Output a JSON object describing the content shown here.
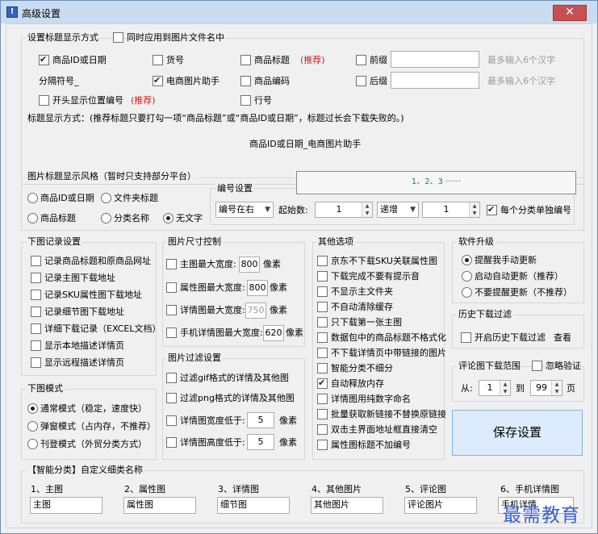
{
  "window": {
    "title": "高级设置",
    "close": "✕"
  },
  "title_settings": {
    "heading": "设置标题显示方式",
    "apply_to_filename": "同时应用到图片文件名中",
    "product_id_date": "商品ID或日期",
    "goods_no": "货号",
    "product_title": "商品标题",
    "recommended": "(推荐)",
    "prefix": "前缀",
    "prefix_hint": "最多输入6个汉字",
    "separator": "分隔符号_",
    "ecommerce_helper": "电商图片助手",
    "product_code": "商品编码",
    "suffix": "后缀",
    "suffix_hint": "最多输入6个汉字",
    "show_position_number": "开头显示位置编号",
    "recommended2": "(推荐)",
    "line_no": "行号",
    "note": "标题显示方式：(推荐标题只要打勾一项“商品标题”或“商品ID或日期”，标题过长会下载失败的。)",
    "preview": "商品ID或日期_电商图片助手"
  },
  "image_title_style": {
    "heading": "图片标题显示风格（暂时只支持部分平台）",
    "opt_id_date": "商品ID或日期",
    "opt_folder_title": "文件夹标题",
    "opt_product_title": "商品标题",
    "opt_category_name": "分类名称",
    "opt_no_text": "无文字"
  },
  "numbering": {
    "heading": "编号设置",
    "preview": "1、2、3 ······",
    "position": "编号在右",
    "start_label": "起始数:",
    "start_value": "1",
    "mode": "递增",
    "step_value": "1",
    "per_category": "每个分类单独编号"
  },
  "download_log": {
    "heading": "下图记录设置",
    "items": [
      "记录商品标题和原商品网址",
      "记录主图下载地址",
      "记录SKU属性图下载地址",
      "记录细节图下载地址",
      "详细下载记录（EXCEL文档）",
      "显示本地描述详情页",
      "显示远程描述详情页"
    ]
  },
  "download_mode": {
    "heading": "下图模式",
    "items": [
      "通常模式（稳定，速度快）",
      "弹窗模式（占内存，不推荐）",
      "刊登模式（外贸分类方式）"
    ]
  },
  "size_control": {
    "heading": "图片尺寸控制",
    "main_max": "主图最大宽度:",
    "main_val": "800",
    "unit": "像素",
    "attr_max": "属性图最大宽度:",
    "attr_val": "800",
    "detail_max": "详情图最大宽度:",
    "detail_val": "750",
    "mobile_max": "手机详情图最大宽度:",
    "mobile_val": "620"
  },
  "image_filter": {
    "heading": "图片过滤设置",
    "gif": "过滤gif格式的详情及其他图",
    "png": "过滤png格式的详情及其他图",
    "width_lt": "详情图宽度低于:",
    "width_val": "5",
    "height_lt": "详情图高度低于:",
    "height_val": "5",
    "unit": "像素"
  },
  "other_options": {
    "heading": "其他选项",
    "items": [
      "京东不下载SKU关联属性图",
      "下载完成不要有提示音",
      "不显示主文件夹",
      "不自动清除缓存",
      "只下载第一张主图",
      "数据包中的商品标题不格式化",
      "不下载详情页中带链接的图片",
      "智能分类不细分",
      "自动释放内存",
      "详情图用纯数字命名",
      "批量获取新链接不替换原链接",
      "双击主界面地址框直接清空",
      "属性图标题不加编号"
    ]
  },
  "upgrade": {
    "heading": "软件升级",
    "items": [
      "提醒我手动更新",
      "启动自动更新（推荐）",
      "不要提醒更新（不推荐）"
    ]
  },
  "history_filter": {
    "heading": "历史下载过滤",
    "enable": "开启历史下载过滤",
    "view": "查看"
  },
  "comment_range": {
    "heading": "评论图下载范围",
    "ignore_verify": "忽略验证",
    "from": "从:",
    "from_val": "1",
    "to": "到",
    "to_val": "99",
    "page": "页"
  },
  "save_button": "保存设置",
  "smart_category": {
    "heading": "【智能分类】自定义细类名称",
    "labels": [
      "1、主图",
      "2、属性图",
      "3、详情图",
      "4、其他图片",
      "5、评论图",
      "6、手机详情图"
    ],
    "values": [
      "主图",
      "属性图",
      "细节图",
      "其他图片",
      "评论图片",
      "手机详情"
    ]
  },
  "watermark": "最需教育"
}
